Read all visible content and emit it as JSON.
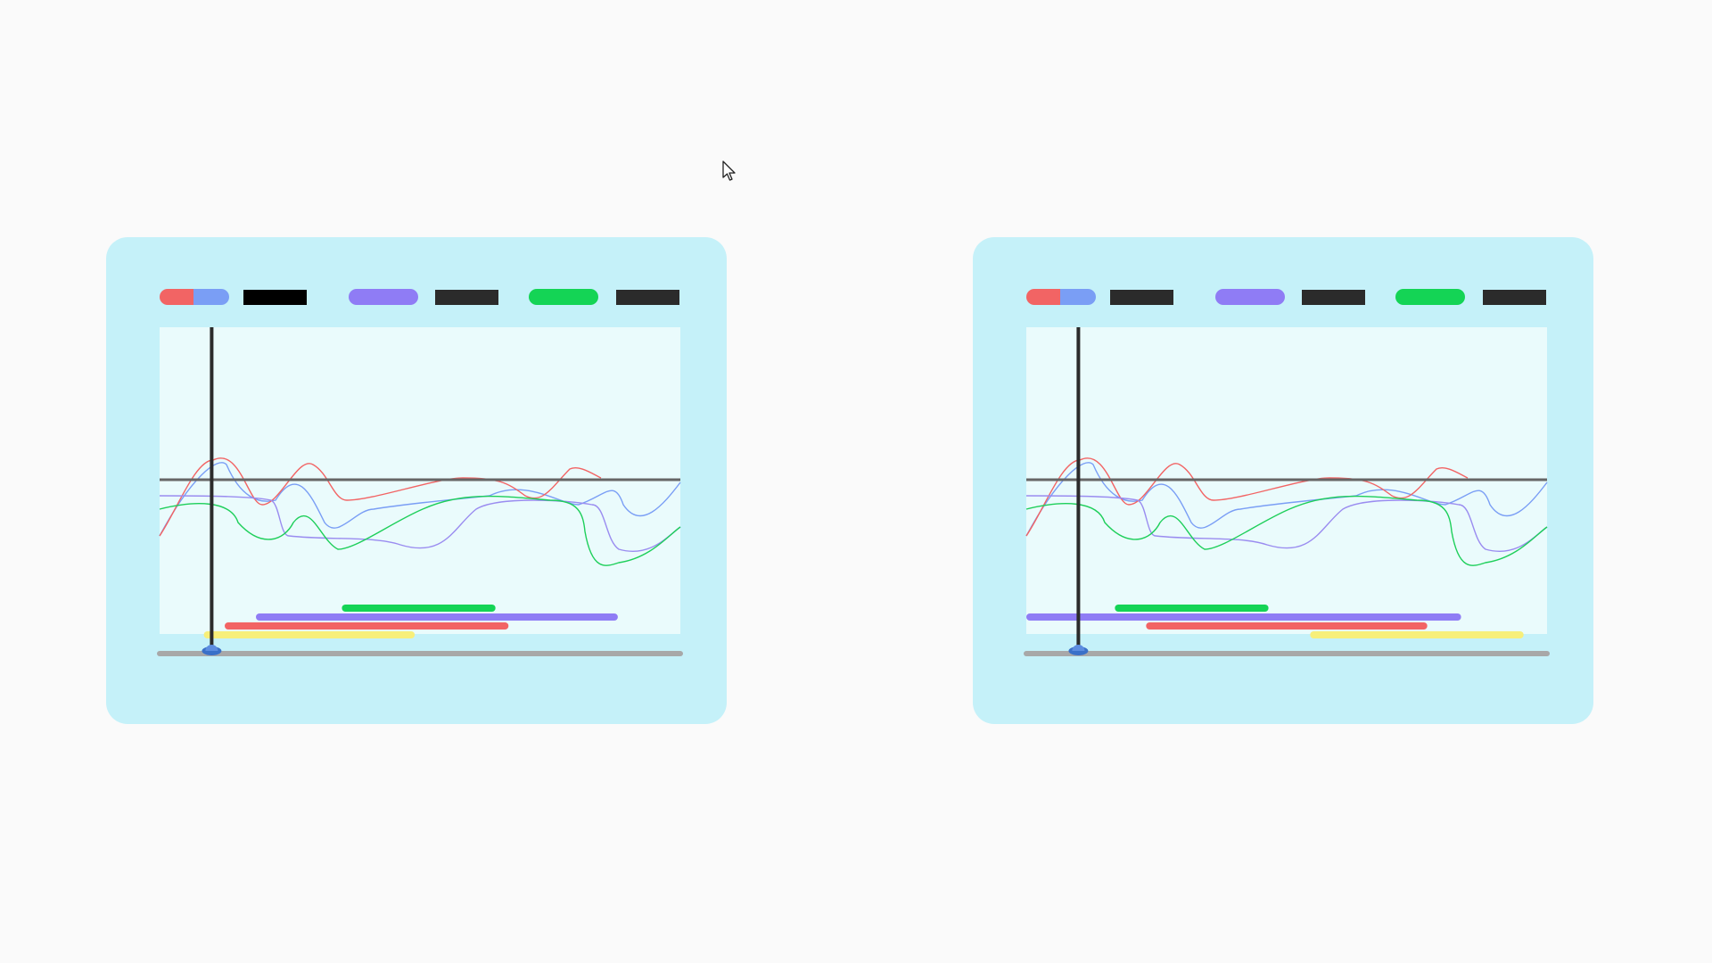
{
  "colors": {
    "background": "#fafafa",
    "panel": "#c5f1f9",
    "plot_area": "#eafbfc",
    "red": "#f26464",
    "blue": "#7a9ef5",
    "purple": "#8f7cf5",
    "green": "#14d455",
    "yellow": "#f7ef7a",
    "dark": "#2b2b2b",
    "black": "#000000",
    "axis_gray": "#a8a8a8",
    "threshold_gray": "#666666",
    "handle": "#3a70c8"
  },
  "cursor": {
    "icon": "mouse-pointer-icon"
  },
  "panels": [
    {
      "id": "left",
      "legend": [
        {
          "swatch": "split",
          "colors": [
            "red",
            "blue"
          ],
          "label_color": "black"
        },
        {
          "swatch": "solid",
          "colors": [
            "purple"
          ],
          "label_color": "dark"
        },
        {
          "swatch": "solid",
          "colors": [
            "green"
          ],
          "label_color": "dark"
        }
      ],
      "playhead_position": 0.1,
      "bars": [
        {
          "color": "green",
          "start": 0.35,
          "end": 0.645
        },
        {
          "color": "purple",
          "start": 0.185,
          "end": 0.88
        },
        {
          "color": "red",
          "start": 0.125,
          "end": 0.67
        },
        {
          "color": "yellow",
          "start": 0.085,
          "end": 0.49
        }
      ]
    },
    {
      "id": "right",
      "legend": [
        {
          "swatch": "split",
          "colors": [
            "red",
            "blue"
          ],
          "label_color": "dark"
        },
        {
          "swatch": "solid",
          "colors": [
            "purple"
          ],
          "label_color": "dark"
        },
        {
          "swatch": "solid",
          "colors": [
            "green"
          ],
          "label_color": "dark"
        }
      ],
      "playhead_position": 0.1,
      "bars": [
        {
          "color": "green",
          "start": 0.17,
          "end": 0.465
        },
        {
          "color": "purple",
          "start": 0.0,
          "end": 0.835
        },
        {
          "color": "red",
          "start": 0.23,
          "end": 0.77
        },
        {
          "color": "yellow",
          "start": 0.545,
          "end": 0.955
        }
      ]
    }
  ]
}
